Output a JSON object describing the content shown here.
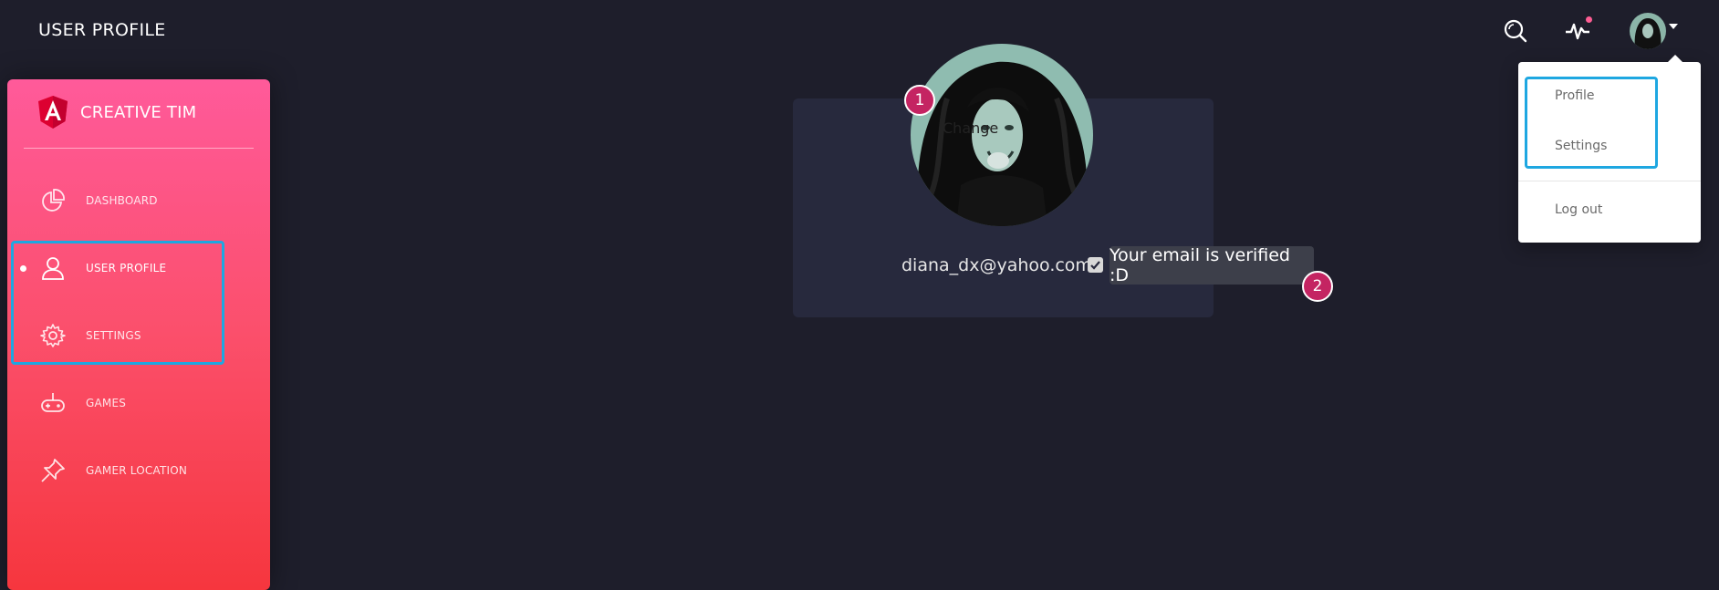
{
  "header": {
    "title": "USER PROFILE"
  },
  "sidebar": {
    "brand": "CREATIVE TIM",
    "items": [
      {
        "label": "DASHBOARD",
        "icon": "chart-pie-icon"
      },
      {
        "label": "USER PROFILE",
        "icon": "user-icon",
        "active": true
      },
      {
        "label": "SETTINGS",
        "icon": "gear-icon"
      },
      {
        "label": "GAMES",
        "icon": "gamepad-icon"
      },
      {
        "label": "GAMER LOCATION",
        "icon": "pin-icon"
      }
    ]
  },
  "profile": {
    "change_label": "Change",
    "email": "diana_dx@yahoo.com",
    "verified_tooltip": "Your email is verified :D"
  },
  "badges": {
    "one": "1",
    "two": "2"
  },
  "dropdown": {
    "items": [
      "Profile",
      "Settings",
      "Log out"
    ]
  },
  "colors": {
    "background": "#1e1e2b",
    "card": "#27293d",
    "sidebar_top": "#ff5a9a",
    "sidebar_bottom": "#f6363e",
    "highlight": "#1ea7e1",
    "badge": "#c42462"
  }
}
